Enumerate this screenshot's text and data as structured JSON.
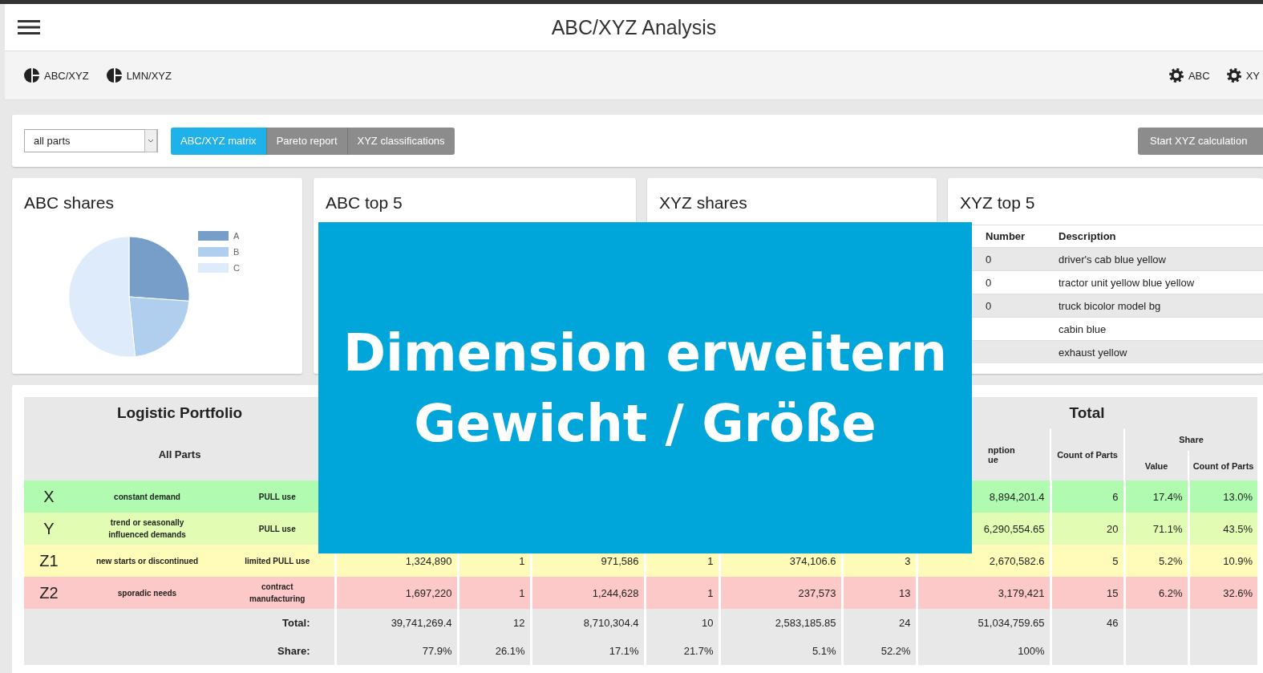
{
  "window": {
    "title": "ABC/XYZ Analysis"
  },
  "toolbar": {
    "left": [
      {
        "label": "ABC/XYZ",
        "kind": "pie"
      },
      {
        "label": "LMN/XYZ",
        "kind": "pie"
      }
    ],
    "right": [
      {
        "label": "ABC",
        "kind": "gear"
      },
      {
        "label": "XY",
        "kind": "gear"
      }
    ]
  },
  "filter": {
    "select_value": "all parts",
    "tabs": [
      {
        "label": "ABC/XYZ matrix",
        "selected": true
      },
      {
        "label": "Pareto report",
        "selected": false
      },
      {
        "label": "XYZ classifications",
        "selected": false
      }
    ],
    "action_button": "Start XYZ calculation"
  },
  "cards": [
    {
      "kind": "pie",
      "title": "ABC shares",
      "legend": [
        {
          "label": "A",
          "color": "#779ec9"
        },
        {
          "label": "B",
          "color": "#b0cfee"
        },
        {
          "label": "C",
          "color": "#ddebfb"
        }
      ]
    },
    {
      "kind": "empty",
      "title": "ABC top 5"
    },
    {
      "kind": "empty",
      "title": "XYZ shares"
    },
    {
      "kind": "table",
      "title": "XYZ top 5",
      "columns": [
        "Number",
        "Description"
      ],
      "rows": [
        {
          "number": "0",
          "description": "driver's cab blue yellow"
        },
        {
          "number": "0",
          "description": "tractor unit yellow blue yellow"
        },
        {
          "number": "0",
          "description": "truck bicolor model bg"
        },
        {
          "description": "cabin blue"
        },
        {
          "description": "exhaust yellow"
        }
      ]
    }
  ],
  "portfolio": {
    "title": "Logistic Portfolio",
    "subtitle": "All Parts",
    "total_title": "Total",
    "total_value_header": [
      "nption",
      "ue"
    ],
    "total_count_header": "Count of Parts",
    "share_header": "Share",
    "share_value_header": "Value",
    "share_count_header": "Count of Parts",
    "rows": [
      {
        "label": "X",
        "description": "constant demand",
        "use": "PULL use",
        "color": "#b0fbb0",
        "values": [
          "8,894,201.4",
          "6",
          "17.4%",
          "13.0%"
        ]
      },
      {
        "label": "Y",
        "description": "trend or seasonally influenced demands",
        "use": "PULL use",
        "color": "#e2fdb3",
        "values": [
          "6,290,554.65",
          "20",
          "71.1%",
          "43.5%"
        ]
      },
      {
        "label": "Z1",
        "description": "new starts or discontinued",
        "use": "limited PULL use",
        "color": "#fefcb8",
        "values": [
          "1,324,890",
          "1",
          "971,586",
          "1",
          "374,106.6",
          "3",
          "2,670,582.6",
          "5",
          "5.2%",
          "10.9%"
        ]
      },
      {
        "label": "Z2",
        "description": "sporadic needs",
        "use": "contract manufacturing",
        "color": "#fdc8c8",
        "values": [
          "1,697,220",
          "1",
          "1,244,628",
          "1",
          "237,573",
          "13",
          "3,179,421",
          "15",
          "6.2%",
          "32.6%"
        ]
      }
    ],
    "footer": [
      {
        "label": "Total:",
        "values": [
          "39,741,269.4",
          "12",
          "8,710,304.4",
          "10",
          "2,583,185.85",
          "24",
          "51,034,759.65",
          "46"
        ]
      },
      {
        "label": "Share:",
        "values": [
          "77.9%",
          "26.1%",
          "17.1%",
          "21.7%",
          "5.1%",
          "52.2%",
          "100%"
        ]
      }
    ]
  },
  "overlay": {
    "lines": [
      "Dimension erweitern",
      "Gewicht / Größe"
    ]
  }
}
